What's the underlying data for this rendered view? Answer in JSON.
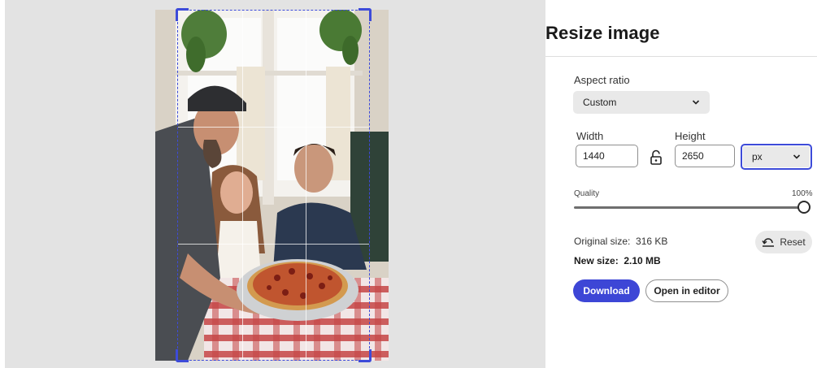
{
  "canvas": {
    "image_alt": "Man serving pizza to two diners at a restaurant table"
  },
  "panel": {
    "title": "Resize image",
    "aspect_ratio": {
      "label": "Aspect ratio",
      "selected": "Custom"
    },
    "dimensions": {
      "width_label": "Width",
      "height_label": "Height",
      "width_value": "1440",
      "height_value": "2650",
      "unit_selected": "px"
    },
    "quality": {
      "label": "Quality",
      "value_text": "100%",
      "value": 1.0
    },
    "sizes": {
      "original_label": "Original size:",
      "original_value": "316 KB",
      "new_label": "New size:",
      "new_value": "2.10 MB"
    },
    "reset_label": "Reset",
    "download_label": "Download",
    "open_editor_label": "Open in editor"
  },
  "colors": {
    "accent": "#3d46d6",
    "crop_border": "#3d4bd9",
    "canvas_bg": "#e3e3e3"
  },
  "icons": {
    "lock": "unlock-icon",
    "chevron": "chevron-down-icon",
    "reset": "undo-icon"
  }
}
